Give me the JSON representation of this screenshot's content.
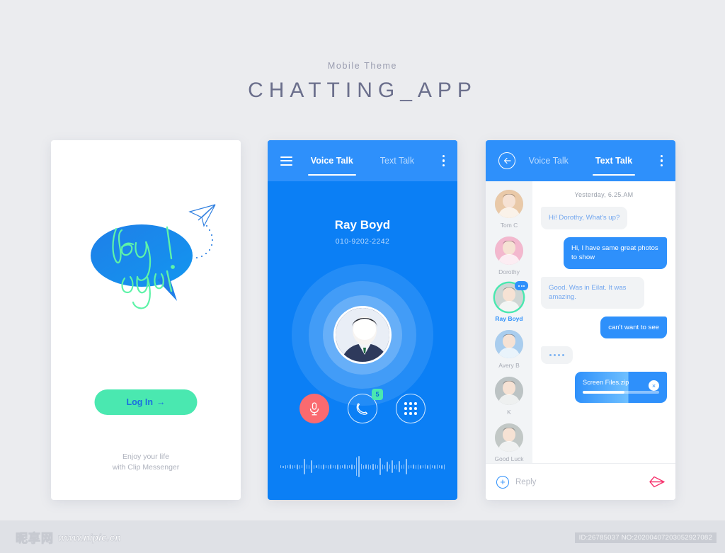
{
  "page": {
    "subtitle": "Mobile Theme",
    "title": "CHATTING_APP",
    "background": "#ebecef"
  },
  "colors": {
    "brand_blue": "#0b7ff5",
    "header_blue": "#2e90fb",
    "mint": "#4ae8b0",
    "red": "#fa6a6f",
    "send_pink": "#f6346e"
  },
  "splash": {
    "bubble_text_line1": "hey",
    "bubble_text_line2": "you!",
    "tagline_line1": "Enjoy your life",
    "tagline_line2": "with Clip Messenger",
    "login_label": "Log In",
    "login_arrow": "→",
    "paper_plane_icon": "paper-plane-icon"
  },
  "voice": {
    "header": {
      "menu_icon": "hamburger-menu-icon",
      "more_icon": "kebab-menu-icon",
      "tabs": [
        {
          "label": "Voice Talk",
          "active": true
        },
        {
          "label": "Text Talk",
          "active": false
        }
      ]
    },
    "contact_name": "Ray Boyd",
    "contact_number": "010-9202-2242",
    "actions": [
      {
        "name": "mute-microphone-button",
        "icon": "microphone-icon",
        "badge": null
      },
      {
        "name": "call-button",
        "icon": "phone-handset-icon",
        "badge": "5"
      },
      {
        "name": "keypad-button",
        "icon": "dialpad-icon",
        "badge": null
      }
    ],
    "waveform": [
      4,
      3,
      5,
      4,
      6,
      5,
      4,
      7,
      5,
      4,
      22,
      6,
      5,
      18,
      5,
      4,
      6,
      5,
      7,
      4,
      5,
      6,
      4,
      5,
      7,
      5,
      4,
      6,
      5,
      4,
      7,
      5,
      26,
      30,
      8,
      5,
      6,
      7,
      5,
      9,
      6,
      5,
      24,
      7,
      5,
      14,
      6,
      18,
      5,
      7,
      16,
      5,
      6,
      22,
      5,
      4,
      6,
      5,
      7,
      5,
      4,
      6,
      5,
      7,
      4,
      5,
      6,
      4,
      5,
      7
    ]
  },
  "text": {
    "header": {
      "back_icon": "back-arrow-icon",
      "more_icon": "kebab-menu-icon",
      "tabs": [
        {
          "label": "Voice Talk",
          "active": false
        },
        {
          "label": "Text Talk",
          "active": true
        }
      ]
    },
    "contacts": [
      {
        "name": "Tom C",
        "active": false,
        "badge": false,
        "avatar": "#e9c9a8"
      },
      {
        "name": "Dorothy",
        "active": false,
        "badge": false,
        "avatar": "#f3b8ce"
      },
      {
        "name": "Ray Boyd",
        "active": true,
        "badge": true,
        "avatar": "#cfd6d4"
      },
      {
        "name": "Avery B",
        "active": false,
        "badge": false,
        "avatar": "#a9cdee"
      },
      {
        "name": "K",
        "active": false,
        "badge": false,
        "avatar": "#bcc3c4"
      },
      {
        "name": "Good Luck",
        "active": false,
        "badge": false,
        "avatar": "#c2c8c6"
      }
    ],
    "timestamp": "Yesterday, 6.25.AM",
    "messages": [
      {
        "type": "text",
        "side": "in",
        "body": "Hi! Dorothy, What's up?"
      },
      {
        "type": "text",
        "side": "out",
        "body": "Hi, I have same great photos to show"
      },
      {
        "type": "text",
        "side": "in",
        "body": "Good. Was in Eilat. It was amazing."
      },
      {
        "type": "text",
        "side": "out",
        "body": "can't want to see"
      },
      {
        "type": "typing",
        "side": "in",
        "body": ""
      },
      {
        "type": "file",
        "side": "out",
        "body": "Screen Files.zip",
        "progress": 55,
        "close_icon": "close-icon"
      }
    ],
    "reply": {
      "add_icon": "plus-circle-icon",
      "placeholder": "Reply",
      "value": "",
      "send_icon": "send-paper-plane-icon"
    }
  },
  "watermark": {
    "logo_cn": "昵享网",
    "logo_url": "www.nipic.cn",
    "id_text": "ID:26785037 NO:20200407203052927082"
  }
}
